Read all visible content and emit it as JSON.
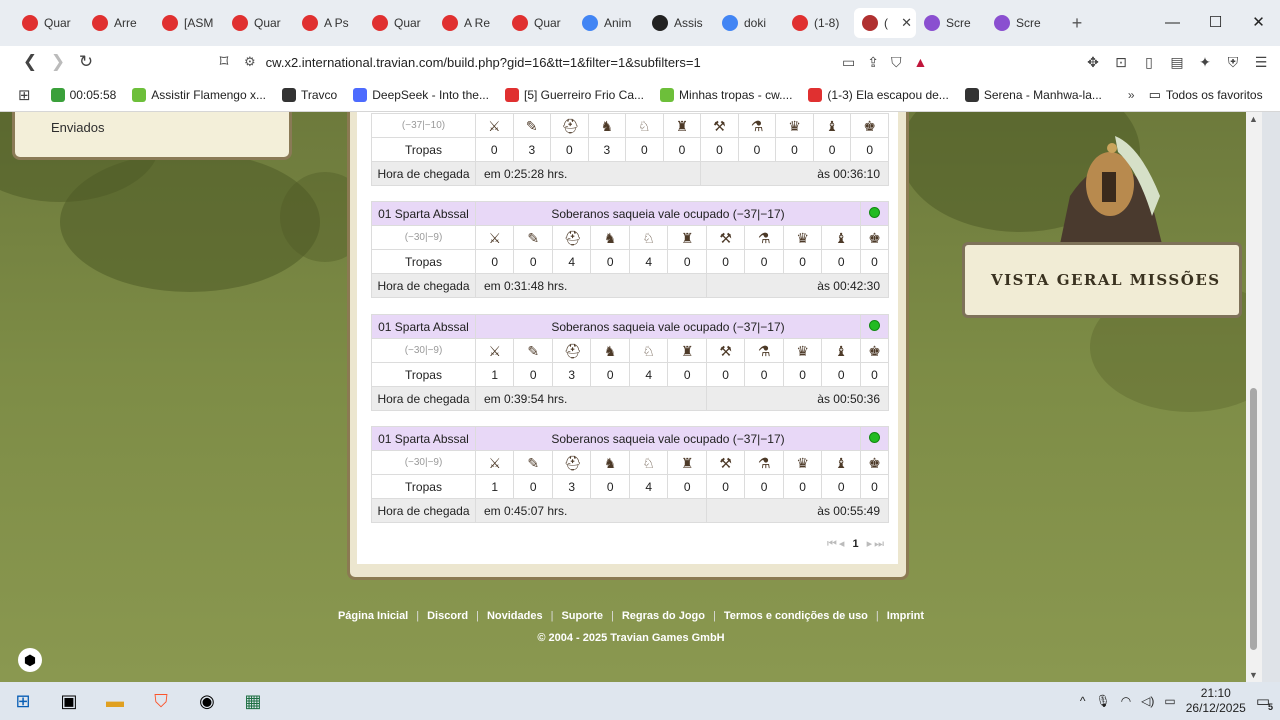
{
  "browser": {
    "tabs": [
      {
        "label": "Quar",
        "color": "#e03030"
      },
      {
        "label": "Arre",
        "color": "#e03030"
      },
      {
        "label": "[ASM",
        "color": "#e03030"
      },
      {
        "label": "Quar",
        "color": "#e03030"
      },
      {
        "label": "A Ps",
        "color": "#e03030"
      },
      {
        "label": "Quar",
        "color": "#e03030"
      },
      {
        "label": "A Re",
        "color": "#e03030"
      },
      {
        "label": "Quar",
        "color": "#e03030"
      },
      {
        "label": "Anim",
        "color": "#4285f4"
      },
      {
        "label": "Assis",
        "color": "#222"
      },
      {
        "label": "doki",
        "color": "#4285f4"
      },
      {
        "label": "(1-8)",
        "color": "#e03030"
      },
      {
        "label": "(",
        "color": "#b03030",
        "active": true
      },
      {
        "label": "Scre",
        "color": "#8a4fd0"
      },
      {
        "label": "Scre",
        "color": "#8a4fd0"
      }
    ],
    "url": "cw.x2.international.travian.com/build.php?gid=16&tt=1&filter=1&subfilters=1",
    "bookmarks": [
      {
        "label": "00:05:58",
        "color": "#3aa03a"
      },
      {
        "label": "Assistir Flamengo x...",
        "color": "#6dbf3a"
      },
      {
        "label": "Travco",
        "color": "#333"
      },
      {
        "label": "DeepSeek - Into the...",
        "color": "#4d6bfe"
      },
      {
        "label": "[5] Guerreiro Frio Ca...",
        "color": "#e03030"
      },
      {
        "label": "Minhas tropas - cw....",
        "color": "#6dbf3a"
      },
      {
        "label": "(1-3) Ela escapou de...",
        "color": "#e03030"
      },
      {
        "label": "Serena - Manhwa-la...",
        "color": "#333"
      }
    ],
    "all_bookmarks": "Todos os favoritos"
  },
  "left_panel": {
    "item": "Enviados"
  },
  "troops_panel": {
    "partial": {
      "coords": "(−37|−10)",
      "troops_label": "Tropas",
      "counts": [
        "0",
        "3",
        "0",
        "3",
        "0",
        "0",
        "0",
        "0",
        "0",
        "0",
        "0"
      ],
      "arrival_label": "Hora de chegada",
      "in_time": "em 0:25:28 hrs.",
      "at_time": "às 00:36:10"
    },
    "movements": [
      {
        "village": "01 Sparta Abssal",
        "mission": "Soberanos saqueia vale ocupado (−37|−17)",
        "coords": "(−30|−9)",
        "troops_label": "Tropas",
        "counts": [
          "0",
          "0",
          "4",
          "0",
          "4",
          "0",
          "0",
          "0",
          "0",
          "0",
          "0"
        ],
        "arrival_label": "Hora de chegada",
        "in_time": "em 0:31:48 hrs.",
        "at_time": "às 00:42:30"
      },
      {
        "village": "01 Sparta Abssal",
        "mission": "Soberanos saqueia vale ocupado (−37|−17)",
        "coords": "(−30|−9)",
        "troops_label": "Tropas",
        "counts": [
          "1",
          "0",
          "3",
          "0",
          "4",
          "0",
          "0",
          "0",
          "0",
          "0",
          "0"
        ],
        "arrival_label": "Hora de chegada",
        "in_time": "em 0:39:54 hrs.",
        "at_time": "às 00:50:36"
      },
      {
        "village": "01 Sparta Abssal",
        "mission": "Soberanos saqueia vale ocupado (−37|−17)",
        "coords": "(−30|−9)",
        "troops_label": "Tropas",
        "counts": [
          "1",
          "0",
          "3",
          "0",
          "4",
          "0",
          "0",
          "0",
          "0",
          "0",
          "0"
        ],
        "arrival_label": "Hora de chegada",
        "in_time": "em 0:45:07 hrs.",
        "at_time": "às 00:55:49"
      }
    ],
    "page": "1",
    "status_color": "#22bb22"
  },
  "quests": {
    "label": "VISTA GERAL MISSÕES"
  },
  "footer": {
    "links": [
      "Página Inicial",
      "Discord",
      "Novidades",
      "Suporte",
      "Regras do Jogo",
      "Termos e condições de uso",
      "Imprint"
    ],
    "copyright": "© 2004 - 2025 Travian Games GmbH"
  },
  "taskbar": {
    "time": "21:10",
    "date": "26/12/2025",
    "notifications": "5"
  }
}
